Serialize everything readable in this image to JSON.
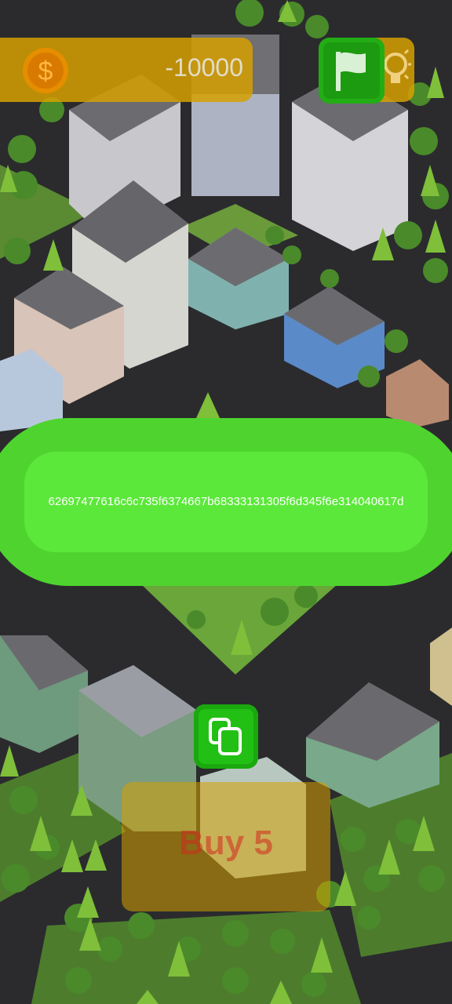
{
  "hud": {
    "money": "-10000",
    "coin_icon": "dollar-coin-icon",
    "hint_icon": "lightbulb-icon",
    "flag_icon": "flag-icon"
  },
  "code_panel": {
    "code": "62697477616c6c735f6374667b68333131305f6d345f6e314040617d",
    "copy_icon": "copy-icon"
  },
  "buy": {
    "label": "Buy 5"
  },
  "colors": {
    "hud_gold": "#d6a000",
    "panel_green": "#4fd42f",
    "button_green": "#22c015",
    "buy_red": "#d2281e"
  }
}
